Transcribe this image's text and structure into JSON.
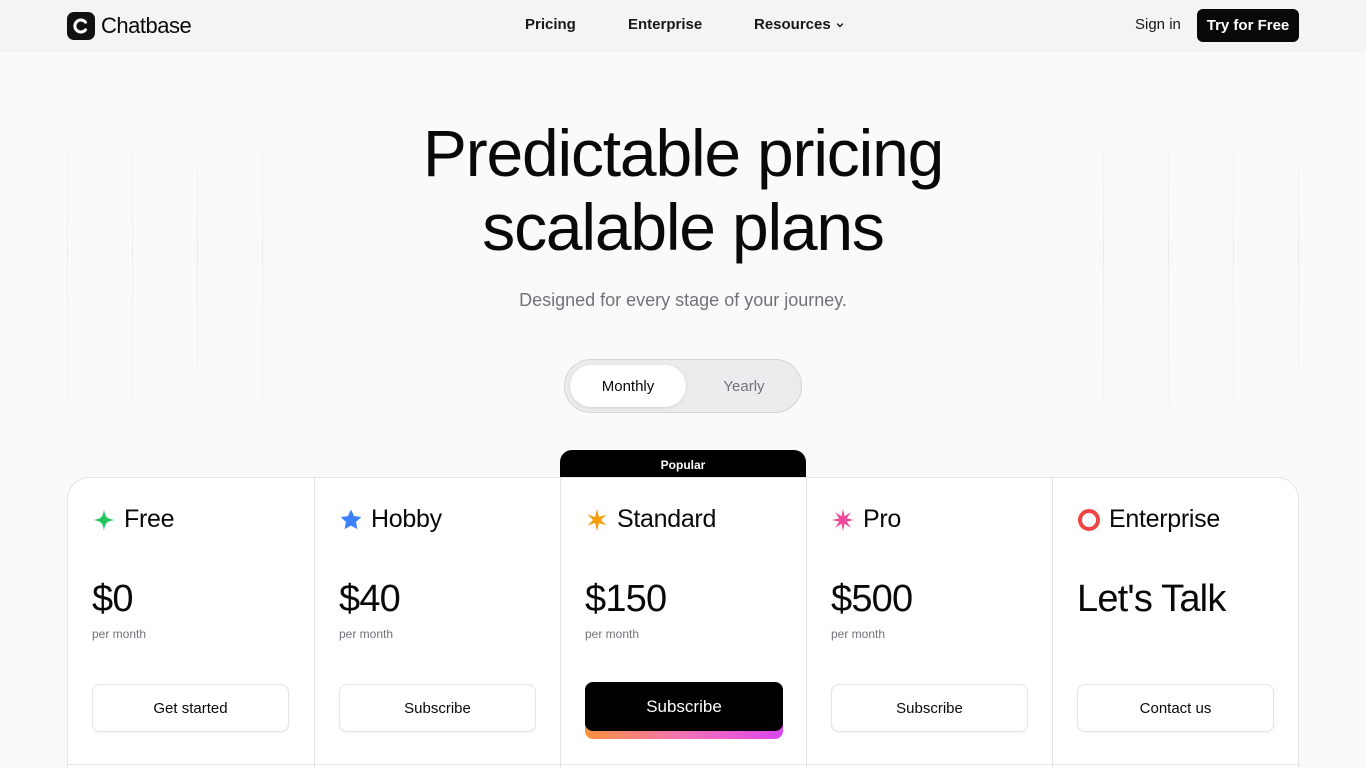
{
  "header": {
    "brand": "Chatbase",
    "nav": {
      "pricing": "Pricing",
      "enterprise": "Enterprise",
      "resources": "Resources"
    },
    "sign_in": "Sign in",
    "cta": "Try for Free"
  },
  "hero": {
    "title_line1": "Predictable pricing",
    "title_line2": "scalable plans",
    "subtitle": "Designed for every stage of your journey."
  },
  "billing_toggle": {
    "monthly": "Monthly",
    "yearly": "Yearly",
    "selected": "Monthly"
  },
  "popular_label": "Popular",
  "plans": [
    {
      "name": "Free",
      "icon": "green-sparkle-icon",
      "color": "#22c55e",
      "price": "$0",
      "period": "per month",
      "button": "Get started"
    },
    {
      "name": "Hobby",
      "icon": "blue-star-icon",
      "color": "#3b82f6",
      "price": "$40",
      "period": "per month",
      "button": "Subscribe"
    },
    {
      "name": "Standard",
      "icon": "orange-star-icon",
      "color": "#f59e0b",
      "price": "$150",
      "period": "per month",
      "button": "Subscribe"
    },
    {
      "name": "Pro",
      "icon": "pink-star-icon",
      "color": "#ec4899",
      "price": "$500",
      "period": "per month",
      "button": "Subscribe"
    },
    {
      "name": "Enterprise",
      "icon": "red-ring-icon",
      "color": "#ef4444",
      "price": "Let's Talk",
      "period": "",
      "button": "Contact us"
    }
  ]
}
